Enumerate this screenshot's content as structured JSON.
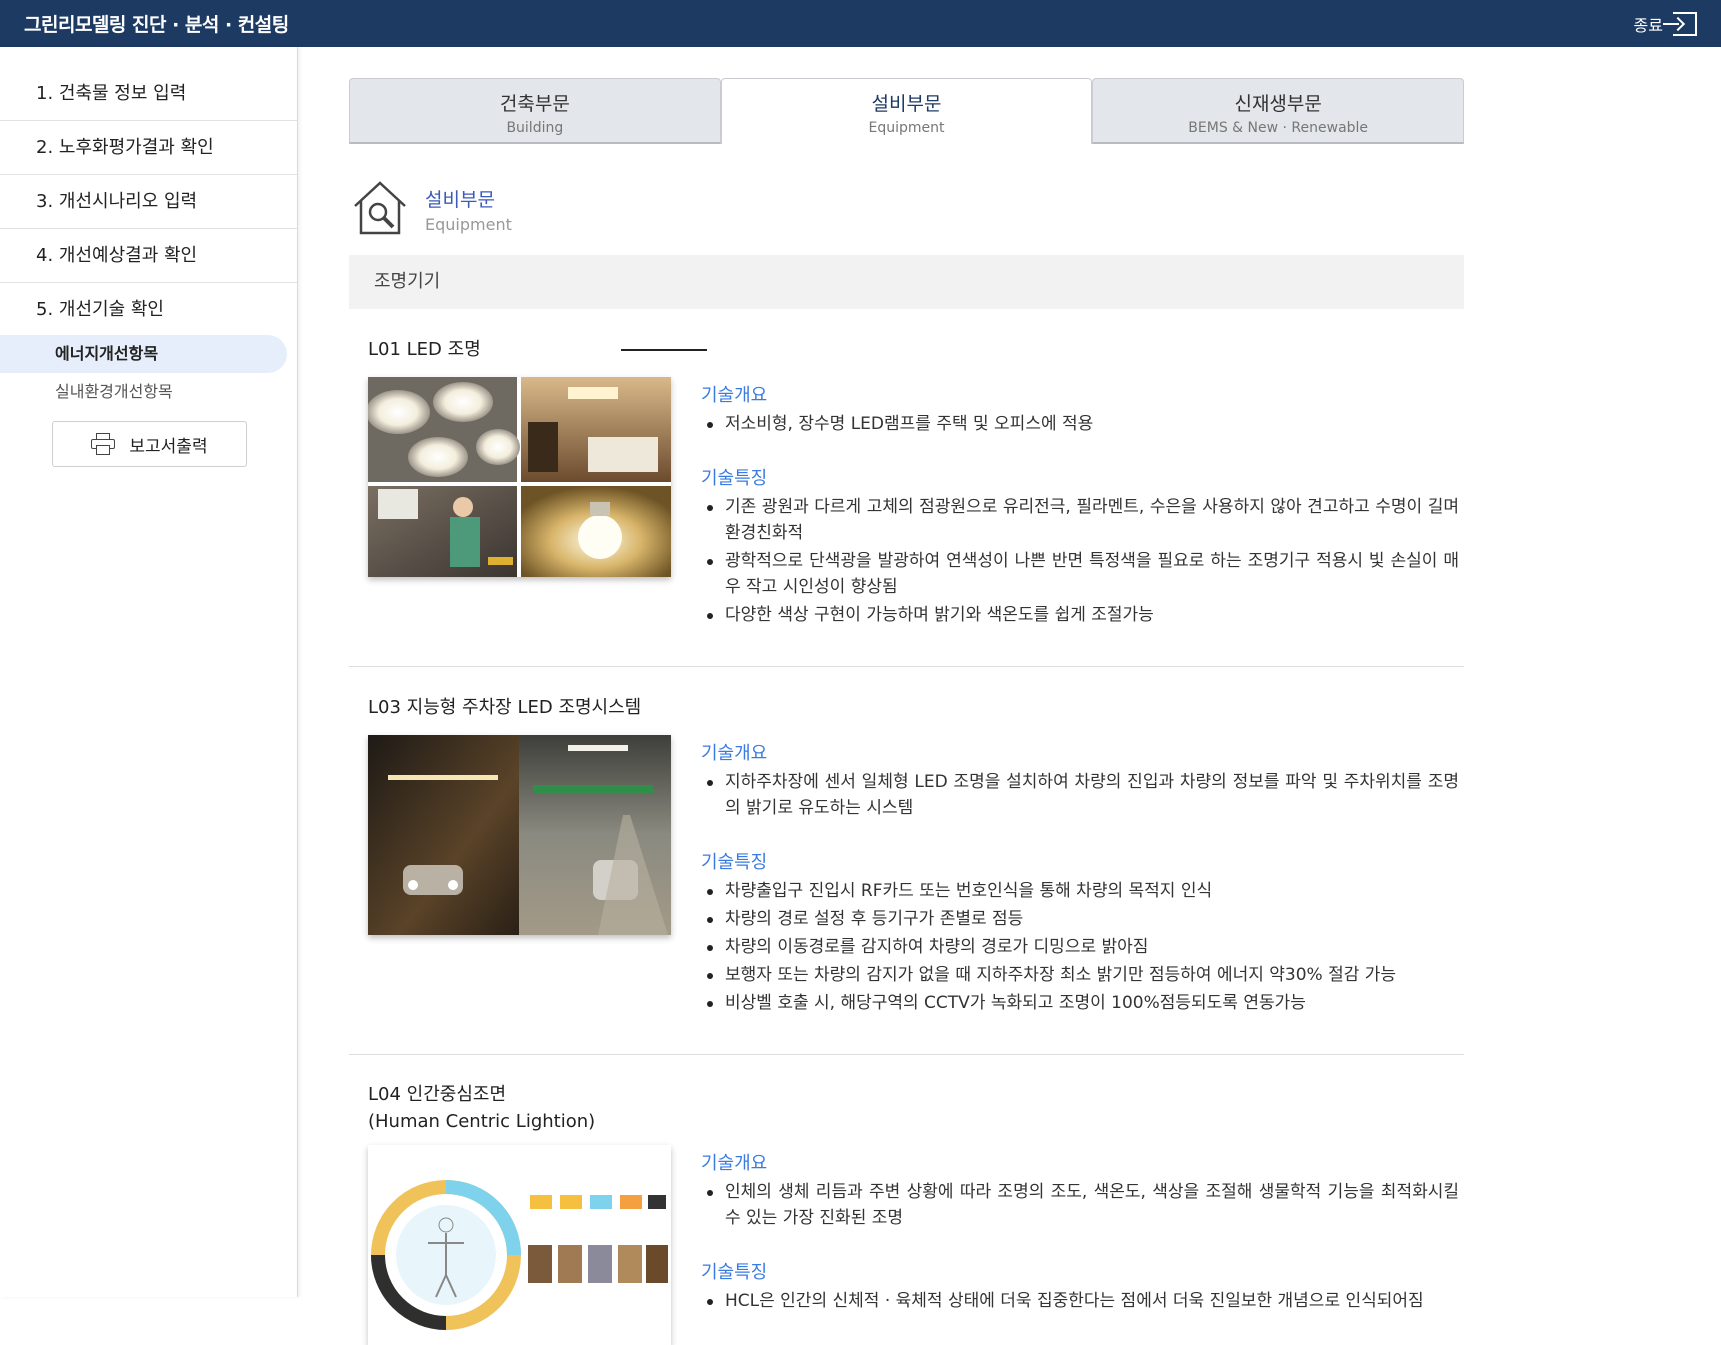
{
  "header": {
    "title": "그린리모델링 진단 · 분석 · 컨설팅",
    "exit_label": "종료"
  },
  "sidebar": {
    "items": [
      {
        "label": "1. 건축물 정보 입력"
      },
      {
        "label": "2. 노후화평가결과 확인"
      },
      {
        "label": "3. 개선시나리오 입력"
      },
      {
        "label": "4. 개선예상결과 확인"
      },
      {
        "label": "5. 개선기술 확인"
      }
    ],
    "subitems": [
      {
        "label": "에너지개선항목",
        "active": true
      },
      {
        "label": "실내환경개선항목",
        "active": false
      }
    ],
    "report_button": "보고서출력"
  },
  "tabs": [
    {
      "label": "건축부문",
      "sub": "Building"
    },
    {
      "label": "설비부문",
      "sub": "Equipment"
    },
    {
      "label": "신재생부문",
      "sub": "BEMS & New · Renewable"
    }
  ],
  "section": {
    "title": "설비부문",
    "subtitle": "Equipment",
    "icon": "house-wrench-icon"
  },
  "category": "조명기기",
  "labels": {
    "overview": "기술개요",
    "features": "기술특징"
  },
  "techs": [
    {
      "title": "L01 LED 조명",
      "overview": [
        "저소비형, 장수명 LED램프를 주택 및 오피스에 적용"
      ],
      "features": [
        "기존 광원과 다르게 고체의 점광원으로 유리전극, 필라멘트, 수은을 사용하지 않아 견고하고 수명이 길며 환경친화적",
        "광학적으로 단색광을 발광하여 연색성이 나쁜 반면 특정색을 필요로 하는 조명기구 적용시 빛 손실이 매우 작고 시인성이 향상됨",
        "다양한 색상 구현이 가능하며 밝기와 색온도를 쉽게 조절가능"
      ]
    },
    {
      "title": "L03 지능형 주차장 LED 조명시스템",
      "overview": [
        "지하주차장에 센서 일체형 LED 조명을 설치하여 차량의 진입과 차량의 정보를 파악 및 주차위치를 조명의 밝기로 유도하는 시스템"
      ],
      "features": [
        "차량출입구 진입시 RF카드 또는 번호인식을 통해 차량의 목적지 인식",
        "차량의 경로 설정 후 등기구가 존별로 점등",
        "차량의 이동경로를 감지하여 차량의 경로가 디밍으로 밝아짐",
        "보행자 또는 차량의 감지가 없을 때 지하주차장 최소 밝기만 점등하여 에너지 약30% 절감 가능",
        "비상벨 호출 시, 해당구역의 CCTV가 녹화되고 조명이 100%점등되도록 연동가능"
      ]
    },
    {
      "title": "L04 인간중심조면",
      "title2": "(Human Centric Lightion)",
      "overview": [
        "인체의 생체 리듬과 주변 상황에 따라 조명의 조도, 색온도, 색상을 조절해 생물학적 기능을 최적화시킬 수 있는 가장 진화된 조명"
      ],
      "features": [
        "HCL은 인간의 신체적 · 육체적 상태에 더욱 집중한다는 점에서 더욱 진일보한 개념으로 인식되어짐"
      ]
    }
  ]
}
